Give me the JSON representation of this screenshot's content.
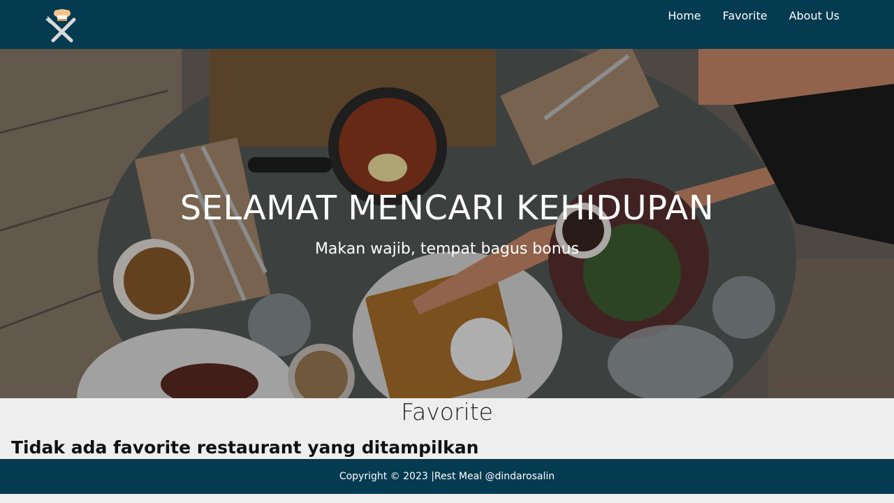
{
  "brand": {
    "logo_icon": "chef-hat-fork-knife-icon"
  },
  "nav": {
    "links": [
      {
        "label": "Home"
      },
      {
        "label": "Favorite"
      },
      {
        "label": "About Us"
      }
    ]
  },
  "hero": {
    "title": "SELAMAT MENCARI KEHIDUPAN",
    "subtitle": "Makan wajib, tempat bagus bonus"
  },
  "main": {
    "heading": "Favorite",
    "empty_message": "Tidak ada favorite restaurant yang ditampilkan"
  },
  "footer": {
    "text": "Copyright © 2023 |Rest Meal @dindarosalin"
  },
  "colors": {
    "navbar": "#053b51",
    "footer": "#053b51",
    "page_bg": "#eeeeee",
    "text_light": "#ffffff"
  }
}
